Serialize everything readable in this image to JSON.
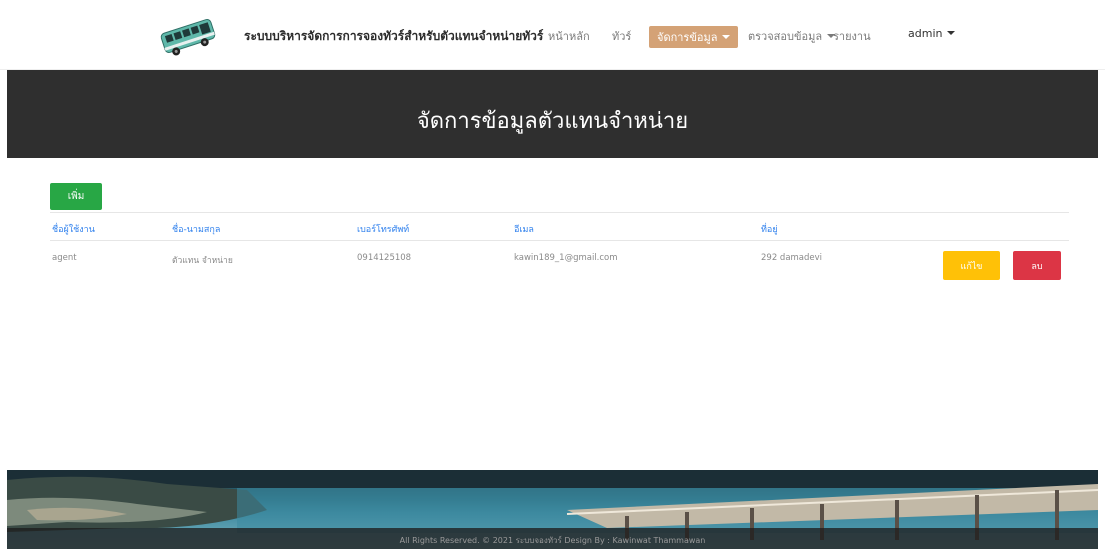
{
  "brand": {
    "title": "ระบบบริหารจัดการการจองทัวร์สำหรับตัวแทนจำหน่ายทัวร์"
  },
  "nav": {
    "home": "หน้าหลัก",
    "tour": "ทัวร์",
    "manage": "จัดการข้อมูล",
    "check": "ตรวจสอบข้อมูล",
    "report": "รายงาน",
    "user": "admin"
  },
  "hero": {
    "title": "จัดการข้อมูลตัวแทนจำหน่าย"
  },
  "toolbar": {
    "add_label": "เพิ่ม"
  },
  "table": {
    "headers": [
      "ชื่อผู้ใช้งาน",
      "ชื่อ-นามสกุล",
      "เบอร์โทรศัพท์",
      "อีเมล",
      "ที่อยู่"
    ],
    "rows": [
      {
        "cells": [
          "agent",
          "ตัวแทน จำหน่าย",
          "0914125108",
          "kawin189_1@gmail.com",
          "292 damadevi"
        ],
        "edit_label": "แก้ไข",
        "delete_label": "ลบ"
      }
    ]
  },
  "footer": {
    "text": "All Rights Reserved. © 2021 ระบบจองทัวร์ Design By : Kawinwat Thammawan"
  },
  "colors": {
    "accent": "#d4a276",
    "add": "#28a745",
    "edit": "#ffc107",
    "delete": "#dc3545",
    "header_link": "#2f80ed",
    "hero": "#2f2f2f"
  }
}
